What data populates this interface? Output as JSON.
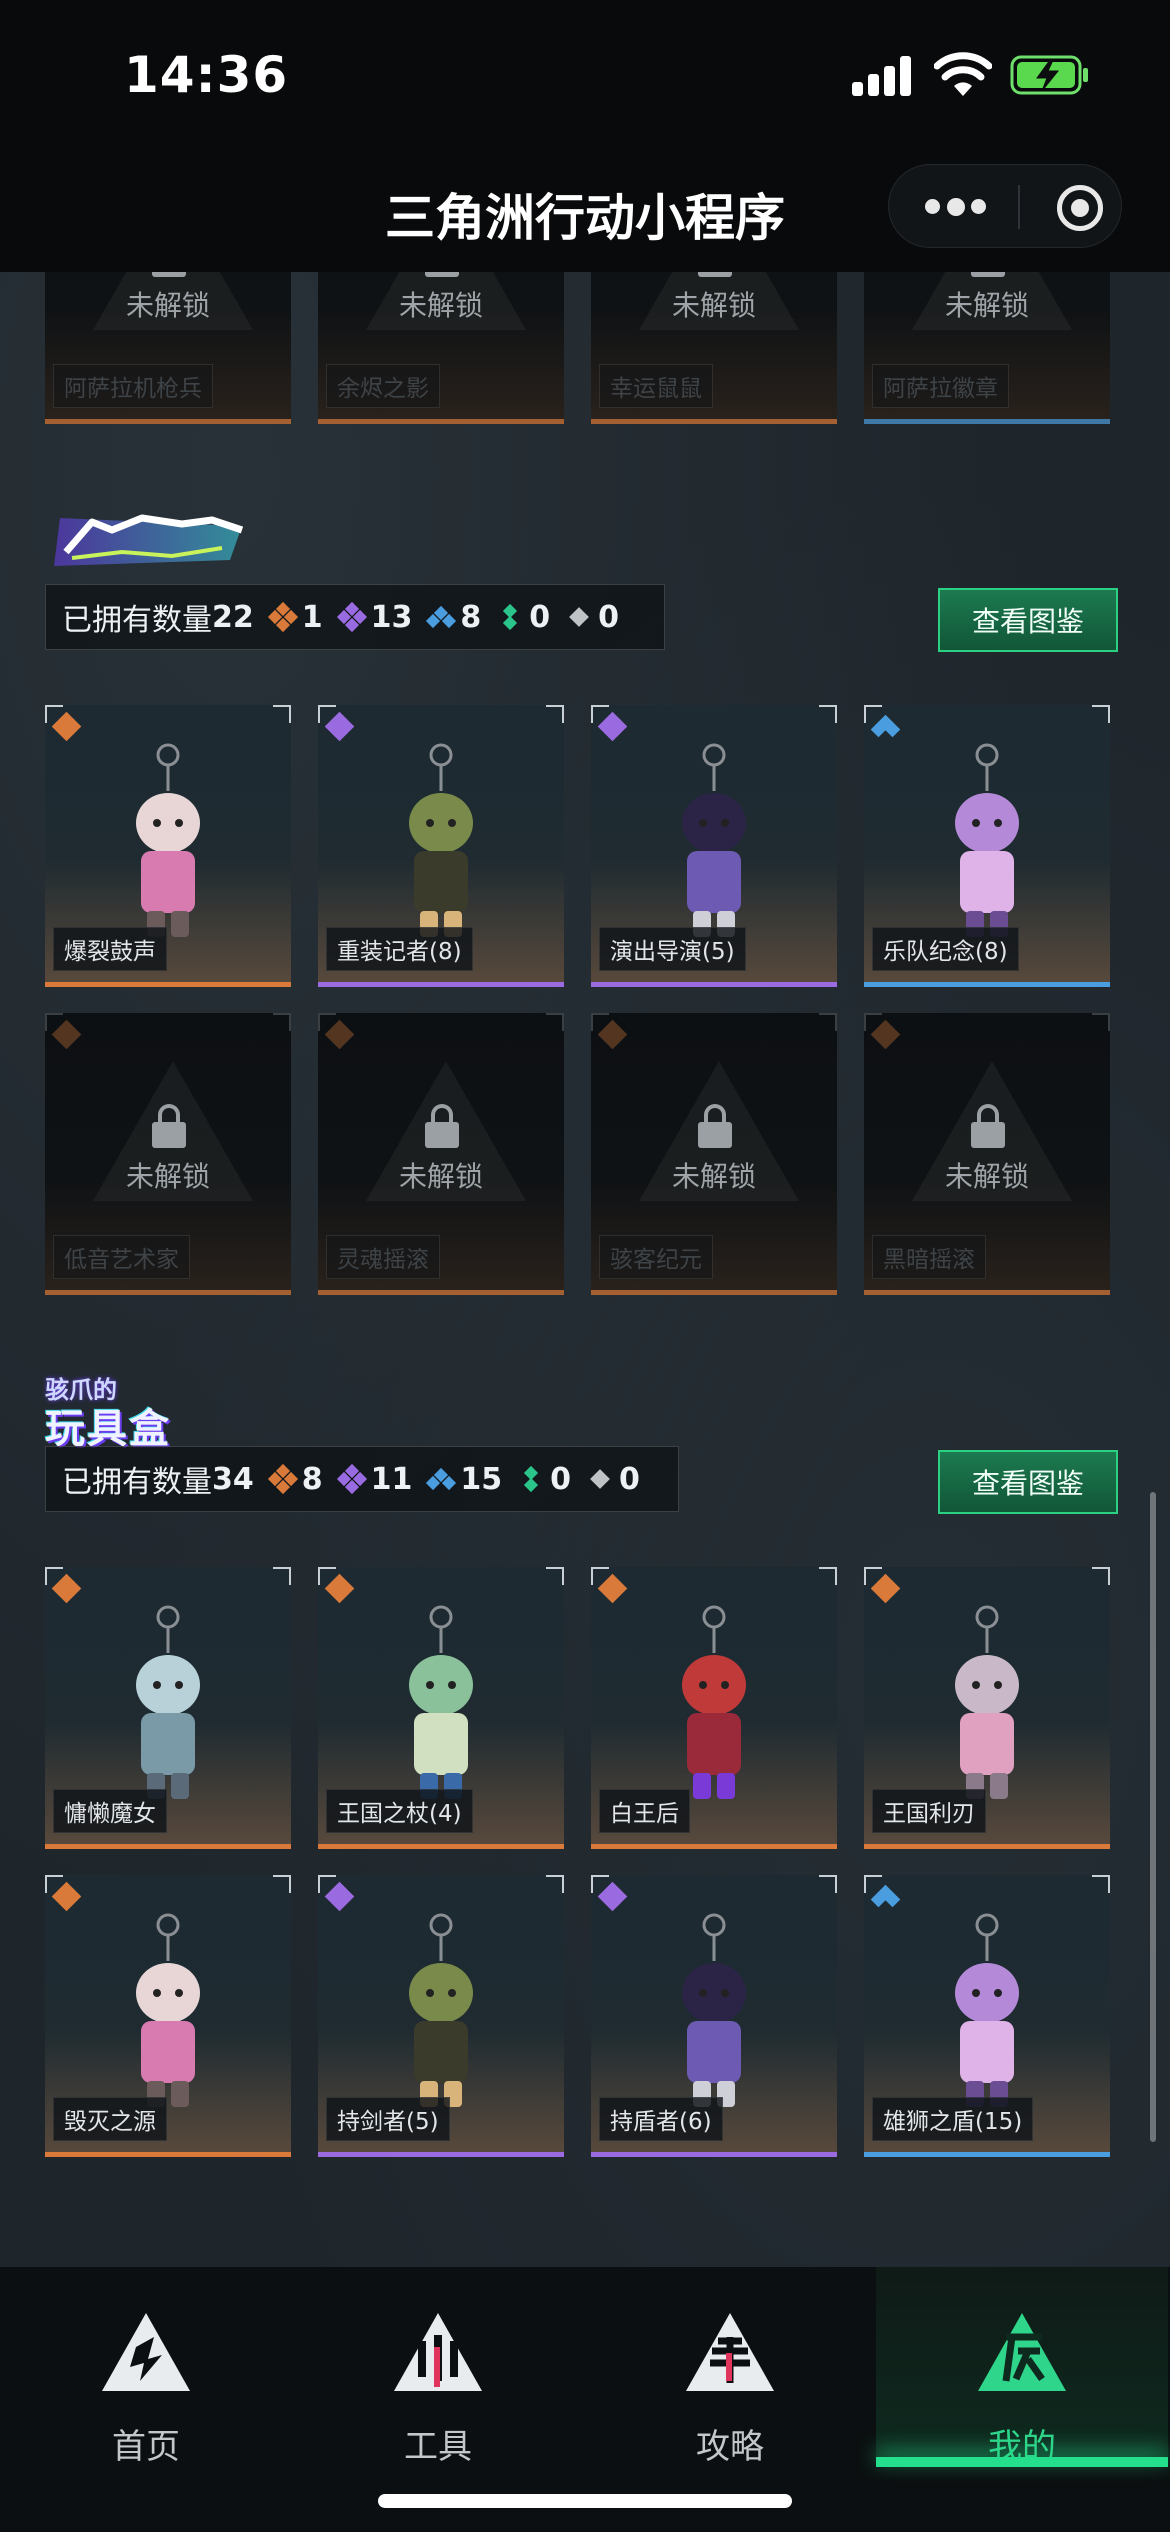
{
  "status_bar": {
    "time": "14:36"
  },
  "nav": {
    "title": "三角洲行动小程序"
  },
  "lock_text": "未解锁",
  "top_row": [
    {
      "name": "阿萨拉机枪兵"
    },
    {
      "name": "余烬之影"
    },
    {
      "name": "幸运鼠鼠"
    },
    {
      "name": "阿萨拉徽章"
    }
  ],
  "sections": [
    {
      "id": "band",
      "owned_label": "已拥有数量",
      "owned_count": "22",
      "counts": [
        "1",
        "13",
        "8",
        "0",
        "0"
      ],
      "view_button": "查看图鉴",
      "items": [
        {
          "name": "爆裂鼓声",
          "rarity": "orange"
        },
        {
          "name": "重装记者(8)",
          "rarity": "purple"
        },
        {
          "name": "演出导演(5)",
          "rarity": "purple"
        },
        {
          "name": "乐队纪念(8)",
          "rarity": "blue"
        },
        {
          "name": "低音艺术家",
          "rarity": "orange",
          "locked": true
        },
        {
          "name": "灵魂摇滚",
          "rarity": "orange",
          "locked": true
        },
        {
          "name": "骇客纪元",
          "rarity": "orange",
          "locked": true
        },
        {
          "name": "黑暗摇滚",
          "rarity": "orange",
          "locked": true
        }
      ]
    },
    {
      "id": "toybox",
      "logo_line1": "骇爪的",
      "logo_line2": "玩具盒",
      "owned_label": "已拥有数量",
      "owned_count": "34",
      "counts": [
        "8",
        "11",
        "15",
        "0",
        "0"
      ],
      "view_button": "查看图鉴",
      "items": [
        {
          "name": "慵懒魔女",
          "rarity": "orange"
        },
        {
          "name": "王国之杖(4)",
          "rarity": "orange"
        },
        {
          "name": "白王后",
          "rarity": "orange"
        },
        {
          "name": "王国利刃",
          "rarity": "orange"
        },
        {
          "name": "毁灭之源",
          "rarity": "orange"
        },
        {
          "name": "持剑者(5)",
          "rarity": "purple"
        },
        {
          "name": "持盾者(6)",
          "rarity": "purple"
        },
        {
          "name": "雄狮之盾(15)",
          "rarity": "blue"
        }
      ]
    }
  ],
  "tabs": [
    {
      "label": "首页"
    },
    {
      "label": "工具"
    },
    {
      "label": "攻略"
    },
    {
      "label": "我的",
      "active": true
    }
  ],
  "colors": {
    "orange": "#d97a3a",
    "purple": "#9a6be0",
    "blue": "#4a9ee0",
    "green": "#2bc48a",
    "gray": "#bfc3c6",
    "accent": "#2fd58a"
  }
}
